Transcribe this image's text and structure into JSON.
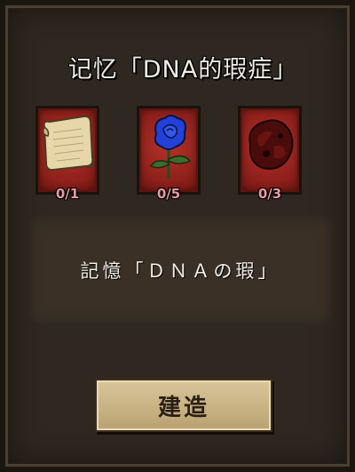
{
  "recipe": {
    "title": "记忆「DNA的瑕症」",
    "ingredients": [
      {
        "icon": "papyrus-scroll-icon",
        "count": "0/1"
      },
      {
        "icon": "blue-rose-icon",
        "count": "0/5"
      },
      {
        "icon": "nightmare-fuel-icon",
        "count": "0/3"
      }
    ],
    "description": "記憶「ＤＮＡの瑕」",
    "build_label": "建造"
  },
  "colors": {
    "panel_bg": "#2f2820",
    "slot_red": "#b5322a",
    "count_text": "#e79aa0",
    "button_parchment": "#d1bc8f"
  }
}
